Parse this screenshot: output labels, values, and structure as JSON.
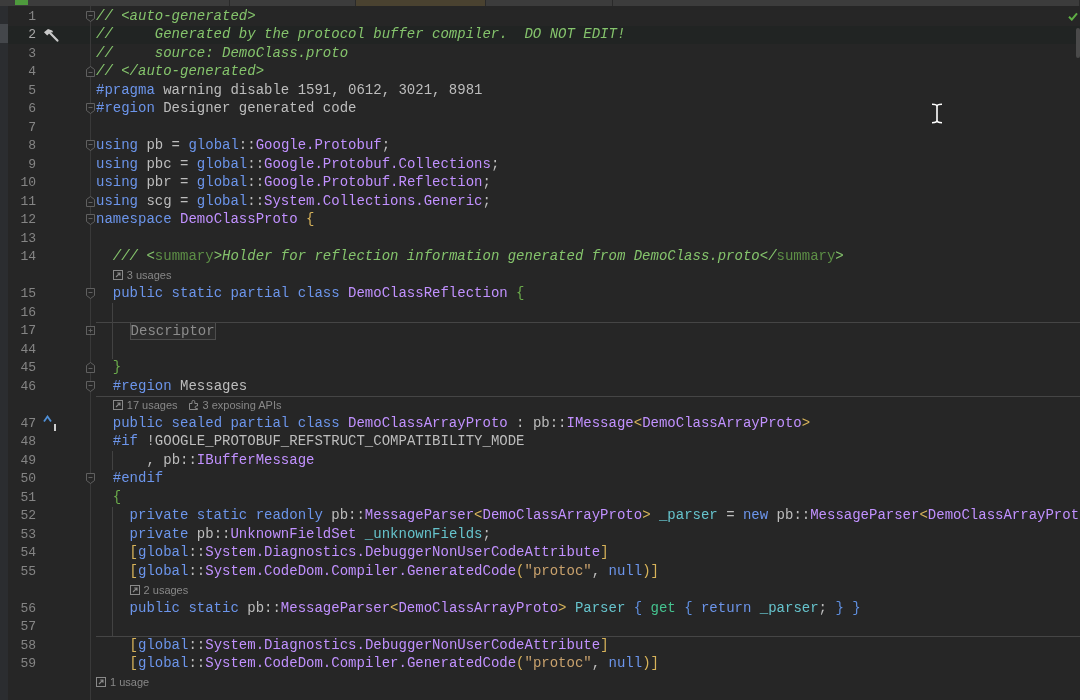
{
  "tab_bar": {
    "tabs": [
      {
        "selected": false,
        "has_icon": true
      },
      {
        "selected": false
      },
      {
        "selected": true
      },
      {
        "selected": false
      },
      {
        "selected": false
      }
    ]
  },
  "editor": {
    "inspection_ok": true,
    "lines": [
      {
        "kind": "code",
        "number": "1",
        "current": false,
        "guide": false,
        "separator": false,
        "fold": {
          "kind": "start"
        },
        "tokens": [
          {
            "kind": "comment",
            "text": "// <auto-generated>"
          }
        ]
      },
      {
        "kind": "code",
        "number": "2",
        "current": true,
        "guide": false,
        "separator": false,
        "gutter_icon": {
          "kind": "build"
        },
        "tokens": [
          {
            "kind": "comment",
            "text": "//     Generated by the protocol buffer compiler.  DO NOT EDIT!"
          }
        ]
      },
      {
        "kind": "code",
        "number": "3",
        "current": false,
        "guide": false,
        "separator": false,
        "tokens": [
          {
            "kind": "comment",
            "text": "//     source: DemoClass.proto"
          }
        ]
      },
      {
        "kind": "code",
        "number": "4",
        "current": false,
        "guide": false,
        "separator": false,
        "fold": {
          "kind": "end"
        },
        "tokens": [
          {
            "kind": "comment",
            "text": "// </auto-generated>"
          }
        ]
      },
      {
        "kind": "code",
        "number": "5",
        "current": false,
        "guide": false,
        "separator": false,
        "tokens": [
          {
            "kind": "keyword",
            "text": "#pragma"
          },
          {
            "kind": "plain",
            "text": " warning disable 1591, 0612, 3021, 8981"
          }
        ]
      },
      {
        "kind": "code",
        "number": "6",
        "current": false,
        "guide": false,
        "separator": false,
        "fold": {
          "kind": "start"
        },
        "tokens": [
          {
            "kind": "keyword",
            "text": "#region"
          },
          {
            "kind": "plain",
            "text": " Designer generated code"
          }
        ]
      },
      {
        "kind": "code",
        "number": "7",
        "current": false,
        "guide": false,
        "separator": false
      },
      {
        "kind": "code",
        "number": "8",
        "current": false,
        "guide": false,
        "separator": false,
        "fold": {
          "kind": "start"
        },
        "tokens": [
          {
            "kind": "keyword",
            "text": "using"
          },
          {
            "kind": "plain",
            "text": " pb = "
          },
          {
            "kind": "keyword",
            "text": "global"
          },
          {
            "kind": "plain",
            "text": "::"
          },
          {
            "kind": "type",
            "text": "Google.Protobuf"
          },
          {
            "kind": "plain",
            "text": ";"
          }
        ]
      },
      {
        "kind": "code",
        "number": "9",
        "current": false,
        "guide": false,
        "separator": false,
        "tokens": [
          {
            "kind": "keyword",
            "text": "using"
          },
          {
            "kind": "plain",
            "text": " pbc = "
          },
          {
            "kind": "keyword",
            "text": "global"
          },
          {
            "kind": "plain",
            "text": "::"
          },
          {
            "kind": "type",
            "text": "Google.Protobuf.Collections"
          },
          {
            "kind": "plain",
            "text": ";"
          }
        ]
      },
      {
        "kind": "code",
        "number": "10",
        "current": false,
        "guide": false,
        "separator": false,
        "tokens": [
          {
            "kind": "keyword",
            "text": "using"
          },
          {
            "kind": "plain",
            "text": " pbr = "
          },
          {
            "kind": "keyword",
            "text": "global"
          },
          {
            "kind": "plain",
            "text": "::"
          },
          {
            "kind": "type",
            "text": "Google.Protobuf.Reflection"
          },
          {
            "kind": "plain",
            "text": ";"
          }
        ]
      },
      {
        "kind": "code",
        "number": "11",
        "current": false,
        "guide": false,
        "separator": false,
        "fold": {
          "kind": "end"
        },
        "tokens": [
          {
            "kind": "keyword",
            "text": "using"
          },
          {
            "kind": "plain",
            "text": " scg = "
          },
          {
            "kind": "keyword",
            "text": "global"
          },
          {
            "kind": "plain",
            "text": "::"
          },
          {
            "kind": "type",
            "text": "System.Collections.Generic"
          },
          {
            "kind": "plain",
            "text": ";"
          }
        ]
      },
      {
        "kind": "code",
        "number": "12",
        "current": false,
        "guide": false,
        "separator": false,
        "fold": {
          "kind": "start"
        },
        "tokens": [
          {
            "kind": "keyword",
            "text": "namespace"
          },
          {
            "kind": "type",
            "text": " DemoClassProto"
          },
          {
            "kind": "bracket1",
            "text": " {"
          }
        ]
      },
      {
        "kind": "code",
        "number": "13",
        "current": false,
        "guide": false,
        "separator": false
      },
      {
        "kind": "code",
        "number": "14",
        "current": false,
        "guide": false,
        "separator": false,
        "tokens": [
          {
            "kind": "comment",
            "text": "  /// <"
          },
          {
            "kind": "doctag",
            "text": "summary"
          },
          {
            "kind": "comment",
            "text": ">Holder for reflection information generated from DemoClass.proto</"
          },
          {
            "kind": "doctag",
            "text": "summary"
          },
          {
            "kind": "comment",
            "text": ">"
          }
        ]
      },
      {
        "kind": "hint",
        "guide": false,
        "separator": false,
        "items": [
          {
            "kind": "usages",
            "text": "3 usages"
          }
        ]
      },
      {
        "kind": "code",
        "number": "15",
        "current": false,
        "guide": false,
        "separator": false,
        "fold": {
          "kind": "start"
        },
        "tokens": [
          {
            "kind": "keyword",
            "text": "  public static partial class"
          },
          {
            "kind": "type",
            "text": " DemoClassReflection"
          },
          {
            "kind": "bracket2",
            "text": " {"
          }
        ]
      },
      {
        "kind": "code",
        "number": "16",
        "current": false,
        "guide": true,
        "separator": false
      },
      {
        "kind": "code",
        "number": "17",
        "current": false,
        "guide": true,
        "separator": true,
        "fold": {
          "kind": "collapsed"
        },
        "tokens": [
          {
            "kind": "folded",
            "text": "    Descriptor"
          }
        ]
      },
      {
        "kind": "code",
        "number": "44",
        "current": false,
        "guide": true,
        "separator": false
      },
      {
        "kind": "code",
        "number": "45",
        "current": false,
        "guide": false,
        "separator": false,
        "fold": {
          "kind": "end"
        },
        "tokens": [
          {
            "kind": "bracket2",
            "text": "  }"
          }
        ]
      },
      {
        "kind": "code",
        "number": "46",
        "current": false,
        "guide": false,
        "separator": false,
        "fold": {
          "kind": "start"
        },
        "tokens": [
          {
            "kind": "keyword",
            "text": "  #region"
          },
          {
            "kind": "plain",
            "text": " Messages"
          }
        ]
      },
      {
        "kind": "hint",
        "guide": false,
        "separator": true,
        "items": [
          {
            "kind": "usages",
            "text": "17 usages"
          },
          {
            "kind": "apis",
            "text": "3 exposing APIs"
          }
        ]
      },
      {
        "kind": "code",
        "number": "47",
        "current": false,
        "guide": false,
        "separator": false,
        "gutter_icon": {
          "kind": "implements"
        },
        "tokens": [
          {
            "kind": "keyword",
            "text": "  public sealed partial class"
          },
          {
            "kind": "type",
            "text": " DemoClassArrayProto"
          },
          {
            "kind": "plain",
            "text": " : pb::"
          },
          {
            "kind": "type",
            "text": "IMessage"
          },
          {
            "kind": "bracket1",
            "text": "<"
          },
          {
            "kind": "type",
            "text": "DemoClassArrayProto"
          },
          {
            "kind": "bracket1",
            "text": ">"
          }
        ]
      },
      {
        "kind": "code",
        "number": "48",
        "current": false,
        "guide": false,
        "separator": false,
        "tokens": [
          {
            "kind": "keyword",
            "text": "  #if"
          },
          {
            "kind": "plain",
            "text": " !GOOGLE_PROTOBUF_REFSTRUCT_COMPATIBILITY_MODE"
          }
        ]
      },
      {
        "kind": "code",
        "number": "49",
        "current": false,
        "guide": true,
        "separator": false,
        "tokens": [
          {
            "kind": "plain",
            "text": "      , pb::"
          },
          {
            "kind": "type",
            "text": "IBufferMessage"
          }
        ]
      },
      {
        "kind": "code",
        "number": "50",
        "current": false,
        "guide": false,
        "separator": false,
        "fold": {
          "kind": "start"
        },
        "tokens": [
          {
            "kind": "keyword",
            "text": "  #endif"
          }
        ]
      },
      {
        "kind": "code",
        "number": "51",
        "current": false,
        "guide": false,
        "separator": false,
        "tokens": [
          {
            "kind": "bracket2",
            "text": "  {"
          }
        ]
      },
      {
        "kind": "code",
        "number": "52",
        "current": false,
        "guide": true,
        "separator": false,
        "tokens": [
          {
            "kind": "keyword",
            "text": "    private static readonly"
          },
          {
            "kind": "plain",
            "text": " pb::"
          },
          {
            "kind": "type",
            "text": "MessageParser"
          },
          {
            "kind": "bracket1",
            "text": "<"
          },
          {
            "kind": "type",
            "text": "DemoClassArrayProto"
          },
          {
            "kind": "bracket1",
            "text": ">"
          },
          {
            "kind": "field",
            "text": " _parser"
          },
          {
            "kind": "plain",
            "text": " = "
          },
          {
            "kind": "keyword",
            "text": "new"
          },
          {
            "kind": "plain",
            "text": " pb::"
          },
          {
            "kind": "type",
            "text": "MessageParser"
          },
          {
            "kind": "bracket1",
            "text": "<"
          },
          {
            "kind": "type",
            "text": "DemoClassArrayProt"
          }
        ]
      },
      {
        "kind": "code",
        "number": "53",
        "current": false,
        "guide": true,
        "separator": false,
        "tokens": [
          {
            "kind": "keyword",
            "text": "    private"
          },
          {
            "kind": "plain",
            "text": " pb::"
          },
          {
            "kind": "type",
            "text": "UnknownFieldSet"
          },
          {
            "kind": "field",
            "text": " _unknownFields"
          },
          {
            "kind": "plain",
            "text": ";"
          }
        ]
      },
      {
        "kind": "code",
        "number": "54",
        "current": false,
        "guide": true,
        "separator": false,
        "tokens": [
          {
            "kind": "bracket1",
            "text": "    ["
          },
          {
            "kind": "keyword",
            "text": "global"
          },
          {
            "kind": "plain",
            "text": "::"
          },
          {
            "kind": "type",
            "text": "System.Diagnostics.DebuggerNonUserCodeAttribute"
          },
          {
            "kind": "bracket1",
            "text": "]"
          }
        ]
      },
      {
        "kind": "code",
        "number": "55",
        "current": false,
        "guide": true,
        "separator": false,
        "tokens": [
          {
            "kind": "bracket1",
            "text": "    ["
          },
          {
            "kind": "keyword",
            "text": "global"
          },
          {
            "kind": "plain",
            "text": "::"
          },
          {
            "kind": "type",
            "text": "System.CodeDom.Compiler.GeneratedCode"
          },
          {
            "kind": "bracket1",
            "text": "("
          },
          {
            "kind": "string",
            "text": "\"protoc\""
          },
          {
            "kind": "plain",
            "text": ", "
          },
          {
            "kind": "keyword",
            "text": "null"
          },
          {
            "kind": "bracket1",
            "text": ")]"
          }
        ]
      },
      {
        "kind": "hint",
        "guide": true,
        "separator": false,
        "items": [
          {
            "kind": "usages",
            "text": "2 usages"
          }
        ]
      },
      {
        "kind": "code",
        "number": "56",
        "current": false,
        "guide": true,
        "separator": false,
        "tokens": [
          {
            "kind": "keyword",
            "text": "    public static"
          },
          {
            "kind": "plain",
            "text": " pb::"
          },
          {
            "kind": "type",
            "text": "MessageParser"
          },
          {
            "kind": "bracket1",
            "text": "<"
          },
          {
            "kind": "type",
            "text": "DemoClassArrayProto"
          },
          {
            "kind": "bracket1",
            "text": ">"
          },
          {
            "kind": "field",
            "text": " Parser"
          },
          {
            "kind": "bracket3",
            "text": " {"
          },
          {
            "kind": "accessor",
            "text": " get"
          },
          {
            "kind": "bracket3",
            "text": " {"
          },
          {
            "kind": "keyword",
            "text": " return"
          },
          {
            "kind": "field",
            "text": " _parser"
          },
          {
            "kind": "plain",
            "text": "; "
          },
          {
            "kind": "bracket3",
            "text": "}"
          },
          {
            "kind": "bracket3",
            "text": " }"
          }
        ]
      },
      {
        "kind": "code",
        "number": "57",
        "current": false,
        "guide": true,
        "separator": false
      },
      {
        "kind": "code",
        "number": "58",
        "current": false,
        "guide": false,
        "separator": true,
        "tokens": [
          {
            "kind": "bracket1",
            "text": "    ["
          },
          {
            "kind": "keyword",
            "text": "global"
          },
          {
            "kind": "plain",
            "text": "::"
          },
          {
            "kind": "type",
            "text": "System.Diagnostics.DebuggerNonUserCodeAttribute"
          },
          {
            "kind": "bracket1",
            "text": "]"
          }
        ]
      },
      {
        "kind": "code",
        "number": "59",
        "current": false,
        "guide": false,
        "separator": false,
        "tokens": [
          {
            "kind": "bracket1",
            "text": "    ["
          },
          {
            "kind": "keyword",
            "text": "global"
          },
          {
            "kind": "plain",
            "text": "::"
          },
          {
            "kind": "type",
            "text": "System.CodeDom.Compiler.GeneratedCode"
          },
          {
            "kind": "bracket1",
            "text": "("
          },
          {
            "kind": "string",
            "text": "\"protoc\""
          },
          {
            "kind": "plain",
            "text": ", "
          },
          {
            "kind": "keyword",
            "text": "null"
          },
          {
            "kind": "bracket1",
            "text": ")]"
          }
        ]
      },
      {
        "kind": "hint",
        "guide": false,
        "separator": false,
        "items": [
          {
            "kind": "usages",
            "text": "1 usage"
          }
        ]
      }
    ]
  }
}
